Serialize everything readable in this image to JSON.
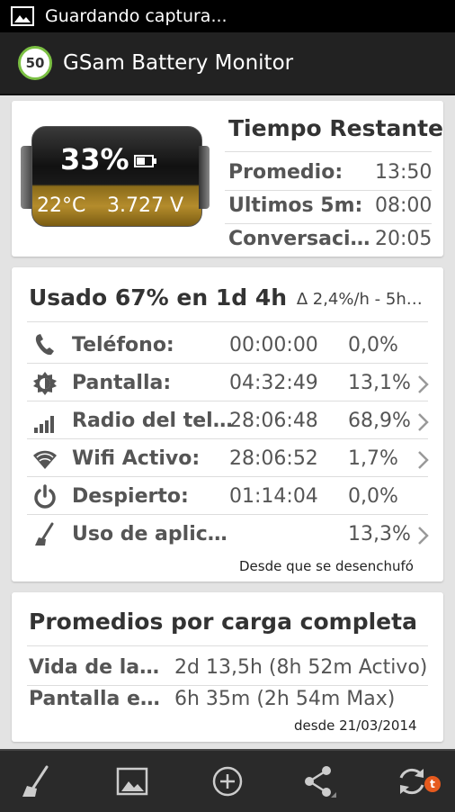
{
  "statusbar": {
    "text": "Guardando captura..."
  },
  "app": {
    "title": "GSam Battery Monitor",
    "logo_number": "50"
  },
  "battery": {
    "percent": "33%",
    "temperature": "22°C",
    "voltage": "3.727 V"
  },
  "time_left": {
    "title": "Tiempo Restante",
    "rows": [
      {
        "label": "Promedio:",
        "value": "13:50"
      },
      {
        "label": "Ultimos 5m:",
        "value": "08:00"
      },
      {
        "label": "Conversaci…",
        "value": "20:05"
      }
    ]
  },
  "usage": {
    "title": "Usado 67% en 1d 4h",
    "rate": "∆ 2,4%/h - 5h…",
    "rows": [
      {
        "icon": "phone-icon",
        "label": "Teléfono:",
        "time": "00:00:00",
        "pct": "0,0%",
        "chevron": false
      },
      {
        "icon": "brightness-icon",
        "label": "Pantalla:",
        "time": "04:32:49",
        "pct": "13,1%",
        "chevron": true
      },
      {
        "icon": "signal-icon",
        "label": "Radio del tel…",
        "time": "28:06:48",
        "pct": "68,9%",
        "chevron": true
      },
      {
        "icon": "wifi-icon",
        "label": "Wifi Activo:",
        "time": "28:06:52",
        "pct": "1,7%",
        "chevron": true
      },
      {
        "icon": "power-icon",
        "label": "Despierto:",
        "time": "01:14:04",
        "pct": "0,0%",
        "chevron": false
      },
      {
        "icon": "broom-icon",
        "label": "Uso de aplic…",
        "time": "",
        "pct": "13,3%",
        "chevron": true
      }
    ],
    "since": "Desde que se desenchufó"
  },
  "averages": {
    "title": "Promedios por carga completa",
    "rows": [
      {
        "label": "Vida de la…",
        "value": "2d 13,5h (8h 52m Activo)"
      },
      {
        "label": "Pantalla e…",
        "value": "6h 35m (2h 54m Max)"
      }
    ],
    "since": "desde 21/03/2014"
  },
  "bottombar": {
    "badge": "t"
  },
  "colors": {
    "accent_green": "#7bc043",
    "badge_orange": "#e65a1e",
    "bar_dark": "#2a2a2a"
  }
}
